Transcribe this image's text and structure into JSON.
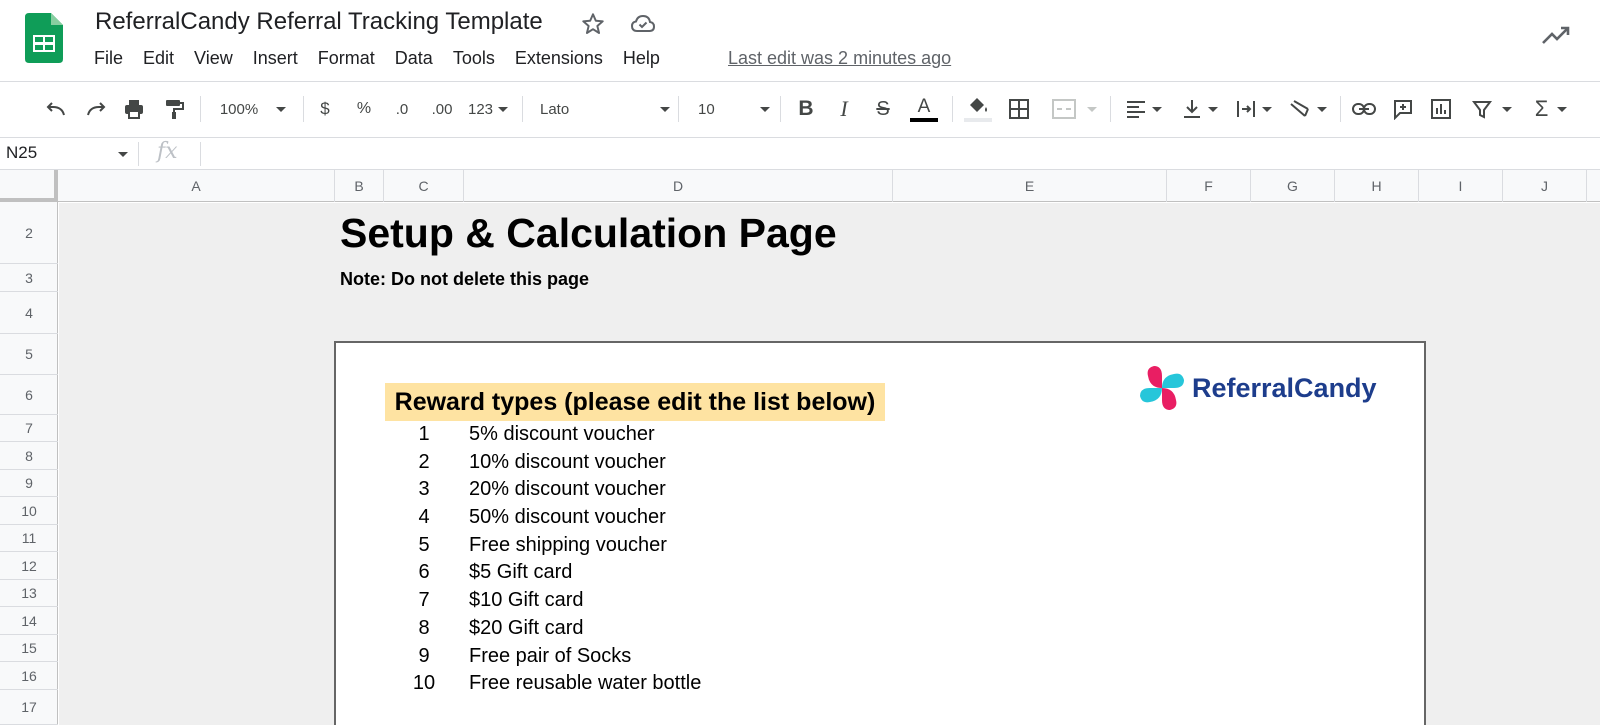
{
  "app": {
    "title": "ReferralCandy Referral Tracking Template",
    "last_edit": "Last edit was 2 minutes ago",
    "menu": [
      "File",
      "Edit",
      "View",
      "Insert",
      "Format",
      "Data",
      "Tools",
      "Extensions",
      "Help"
    ]
  },
  "toolbar": {
    "zoom": "100%",
    "currency": "$",
    "percent": "%",
    "decrease_decimals": ".0",
    "increase_decimals": ".00",
    "more_formats": "123",
    "font": "Lato",
    "font_size": "10"
  },
  "formula_bar": {
    "cell_ref": "N25",
    "fx": "fx"
  },
  "grid": {
    "columns": [
      "A",
      "B",
      "C",
      "D",
      "E",
      "F",
      "G",
      "H",
      "I",
      "J"
    ],
    "rows": [
      "2",
      "3",
      "4",
      "5",
      "6",
      "7",
      "8",
      "9",
      "10",
      "11",
      "12",
      "13",
      "14",
      "15",
      "16",
      "17"
    ]
  },
  "sheet": {
    "title": "Setup & Calculation Page",
    "note": "Note: Do not delete this page",
    "brand": "ReferralCandy",
    "reward_heading": "Reward types (please edit the list below)",
    "rewards": [
      {
        "num": "1",
        "label": "5% discount voucher"
      },
      {
        "num": "2",
        "label": "10% discount voucher"
      },
      {
        "num": "3",
        "label": "20% discount voucher"
      },
      {
        "num": "4",
        "label": "50% discount voucher"
      },
      {
        "num": "5",
        "label": "Free shipping voucher"
      },
      {
        "num": "6",
        "label": "$5 Gift card"
      },
      {
        "num": "7",
        "label": "$10 Gift card"
      },
      {
        "num": "8",
        "label": "$20 Gift card"
      },
      {
        "num": "9",
        "label": "Free pair of Socks"
      },
      {
        "num": "10",
        "label": "Free reusable water bottle"
      }
    ]
  },
  "colors": {
    "sheets_green": "#0f9d58",
    "heading_fill": "#fee3a2",
    "brand_blue": "#1d3d8c",
    "brand_pink": "#e91e63",
    "brand_cyan": "#26c6da"
  }
}
